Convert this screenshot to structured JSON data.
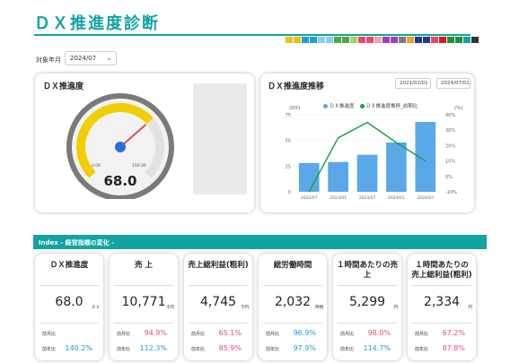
{
  "header": {
    "title": "ＤＸ推進度診断",
    "desc_line1": "",
    "desc_line2": ""
  },
  "palette": [
    "#e8c417",
    "#e8c417",
    "#1e9ed9",
    "#1e9ed9",
    "#8ad0f0",
    "#8ad0f0",
    "#4aa84a",
    "#4aa84a",
    "#a6d55a",
    "#e84b6b",
    "#e84b6b",
    "#f3a6a6",
    "#9f3dbf",
    "#9f3dbf",
    "#7a7a7a",
    "#f39c2a",
    "#1a3d8f",
    "#1a3d8f",
    "#e8456b",
    "#d11b1b",
    "#1a8f3d",
    "#1a8f3d",
    "#12a3a3",
    "#333333"
  ],
  "filter": {
    "label": "対象年月",
    "value": "2024/07"
  },
  "gauge": {
    "title": "ＤＸ推進度",
    "value": "68.0",
    "value_num": 68,
    "min": "0.00",
    "max": "100.00",
    "note": ""
  },
  "trend": {
    "title": "ＤＸ推進度推移",
    "date_from": "2021/01/01",
    "date_to": "2024/07/01",
    "left_unit": "(DX)",
    "right_unit": "(%)",
    "legend": [
      "ＤＸ推進度",
      "ＤＸ推進度推移_前期比"
    ]
  },
  "chart_data": {
    "type": "bar+line",
    "categories": [
      "2022/07",
      "2023/01",
      "2023/07",
      "2024/01",
      "2024/07"
    ],
    "series": [
      {
        "name": "ＤＸ推進度",
        "type": "bar",
        "values": [
          28,
          29,
          36,
          48,
          68
        ]
      },
      {
        "name": "ＤＸ推進度推移_前期比",
        "type": "line",
        "values": [
          -10,
          25,
          35,
          22,
          10
        ]
      }
    ],
    "y_left": {
      "min": 0,
      "max": 75,
      "ticks": [
        "0",
        "25",
        "50",
        "75"
      ]
    },
    "y_right": {
      "min": -10,
      "max": 40,
      "ticks": [
        "-10%",
        "0%",
        "10%",
        "20%",
        "30%",
        "40%"
      ]
    },
    "y_left_label": "",
    "y_right_label": ""
  },
  "index_bar": {
    "label": "Index ‐ 経営指標の変化 -"
  },
  "kpis": [
    {
      "title": "ＤＸ推進度",
      "value": "68.0",
      "unit": "ＤＸ",
      "r1_label": "前月比",
      "r1": "",
      "r2_label": "前年比",
      "r2": "140.2%",
      "r1_color": "red",
      "r2_color": "blue"
    },
    {
      "title": "売 上",
      "value": "10,771",
      "unit": "千円",
      "r1_label": "前月比",
      "r1": "94.9%",
      "r2_label": "前年比",
      "r2": "112.3%",
      "r1_color": "red",
      "r2_color": "blue"
    },
    {
      "title": "売上総利益(粗利)",
      "value": "4,745",
      "unit": "千円",
      "r1_label": "前月比",
      "r1": "65.1%",
      "r2_label": "前年比",
      "r2": "85.9%",
      "r1_color": "red",
      "r2_color": "red"
    },
    {
      "title": "総労働時間",
      "value": "2,032",
      "unit": "時間",
      "r1_label": "前月比",
      "r1": "96.9%",
      "r2_label": "前年比",
      "r2": "97.9%",
      "r1_color": "blue",
      "r2_color": "blue"
    },
    {
      "title": "１時間あたりの売上",
      "value": "5,299",
      "unit": "円",
      "r1_label": "前月比",
      "r1": "98.0%",
      "r2_label": "前年比",
      "r2": "114.7%",
      "r1_color": "red",
      "r2_color": "blue"
    },
    {
      "title": "１時間あたりの\n売上総利益(粗利)",
      "value": "2,334",
      "unit": "円",
      "r1_label": "前月比",
      "r1": "67.2%",
      "r2_label": "前年比",
      "r2": "87.8%",
      "r1_color": "red",
      "r2_color": "red"
    }
  ]
}
